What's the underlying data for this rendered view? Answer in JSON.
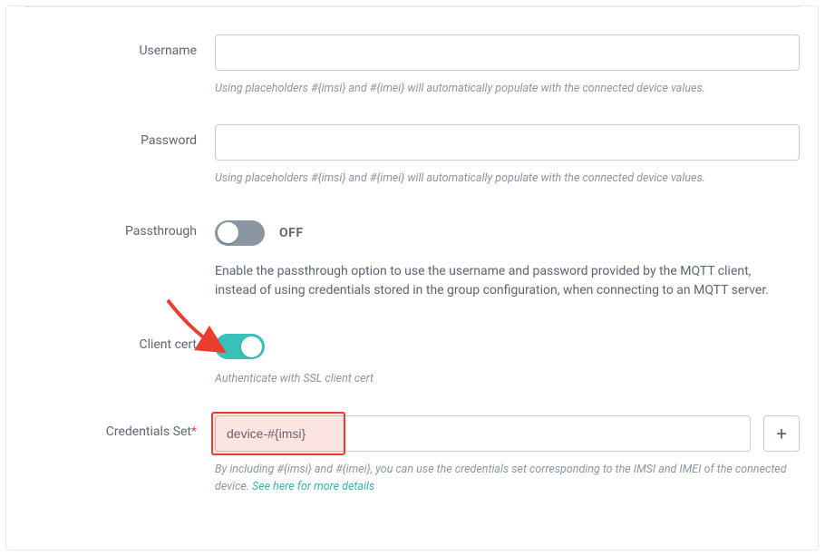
{
  "username": {
    "label": "Username",
    "value": "",
    "hint": "Using placeholders #{imsi} and #{imei} will automatically populate with the connected device values."
  },
  "password": {
    "label": "Password",
    "value": "",
    "hint": "Using placeholders #{imsi} and #{imei} will automatically populate with the connected device values."
  },
  "passthrough": {
    "label": "Passthrough",
    "state_label": "OFF",
    "on": false,
    "desc": "Enable the passthrough option to use the username and password provided by the MQTT client, instead of using credentials stored in the group configuration, when connecting to an MQTT server."
  },
  "client_cert": {
    "label": "Client cert",
    "on": true,
    "hint": "Authenticate with SSL client cert"
  },
  "credentials_set": {
    "label": "Credentials Set",
    "required_mark": "*",
    "value": "device-#{imsi}",
    "hint_prefix": "By including #{imsi} and #{imei}, you can use the credentials set corresponding to the IMSI and IMEI of the connected device. ",
    "hint_link": "See here for more details"
  },
  "icons": {
    "plus": "+"
  }
}
